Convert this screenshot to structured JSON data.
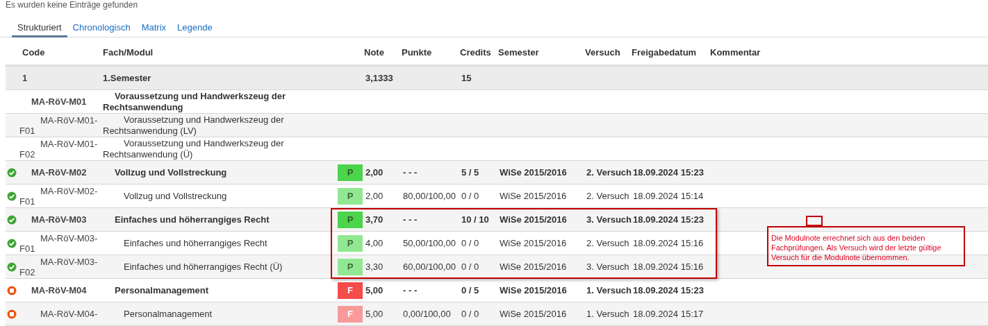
{
  "message": "Es wurden keine Einträge gefunden",
  "tabs": [
    {
      "label": "Strukturiert",
      "selected": true
    },
    {
      "label": "Chronologisch",
      "selected": false
    },
    {
      "label": "Matrix",
      "selected": false
    },
    {
      "label": "Legende",
      "selected": false
    }
  ],
  "columns": [
    "Code",
    "Fach/Modul",
    "Note",
    "Punkte",
    "Credits",
    "Semester",
    "Versuch",
    "Freigabedatum",
    "Kommentar"
  ],
  "rows": [
    {
      "kind": "semester",
      "number": "1",
      "title": "1.Semester",
      "note": "3,1333",
      "credits": "15"
    },
    {
      "kind": "module",
      "code": "MA-RöV-M01",
      "title": "Voraussetzung und Handwerkszeug der Rechtsanwendung"
    },
    {
      "kind": "exam",
      "code": "MA-RöV-M01-",
      "code_suffix": "F01",
      "title": "Voraussetzung und Handwerkszeug der Rechtsanwendung (LV)"
    },
    {
      "kind": "exam",
      "code": "MA-RöV-M01-",
      "code_suffix": "F02",
      "title": "Voraussetzung und Handwerkszeug der Rechtsanwendung (Ü)"
    },
    {
      "kind": "module",
      "passed": true,
      "code": "MA-RöV-M02",
      "title": "Vollzug und Vollstreckung",
      "badge": "P",
      "note": "2,00",
      "punkte": "- - -",
      "credits": "5 / 5",
      "semester": "WiSe 2015/2016",
      "versuch": "2. Versuch",
      "freigabe": "18.09.2024 15:23"
    },
    {
      "kind": "exam",
      "passed": true,
      "code": "MA-RöV-M02-",
      "code_suffix": "F01",
      "title": "Vollzug und Vollstreckung",
      "badge": "P",
      "note": "2,00",
      "punkte": "80,00/100,00",
      "credits": "0 / 0",
      "semester": "WiSe 2015/2016",
      "versuch": "2. Versuch",
      "freigabe": "18.09.2024 15:14"
    },
    {
      "kind": "module",
      "passed": true,
      "code": "MA-RöV-M03",
      "title": "Einfaches und höherrangiges Recht",
      "badge": "P",
      "note": "3,70",
      "punkte": "- - -",
      "credits": "10 / 10",
      "semester": "WiSe 2015/2016",
      "versuch": "3. Versuch",
      "freigabe": "18.09.2024 15:23",
      "highlighted": true
    },
    {
      "kind": "exam",
      "passed": true,
      "code": "MA-RöV-M03-",
      "code_suffix": "F01",
      "title": "Einfaches und höherrangiges Recht",
      "badge": "P",
      "note": "4,00",
      "punkte": "50,00/100,00",
      "credits": "0 / 0",
      "semester": "WiSe 2015/2016",
      "versuch": "2. Versuch",
      "freigabe": "18.09.2024 15:16",
      "highlighted": true
    },
    {
      "kind": "exam",
      "passed": true,
      "code": "MA-RöV-M03-",
      "code_suffix": "F02",
      "title": "Einfaches und höherrangiges Recht (Ü)",
      "badge": "P",
      "note": "3,30",
      "punkte": "60,00/100,00",
      "credits": "0 / 0",
      "semester": "WiSe 2015/2016",
      "versuch": "3. Versuch",
      "freigabe": "18.09.2024 15:16",
      "highlighted": true
    },
    {
      "kind": "module",
      "passed": false,
      "code": "MA-RöV-M04",
      "title": "Personalmanagement",
      "badge": "F",
      "note": "5,00",
      "punkte": "- - -",
      "credits": "0 / 5",
      "semester": "WiSe 2015/2016",
      "versuch": "1. Versuch",
      "freigabe": "18.09.2024 15:23"
    },
    {
      "kind": "exam",
      "passed": false,
      "code": "MA-RöV-M04-",
      "title": "Personalmanagement",
      "badge": "F",
      "note": "5,00",
      "punkte": "0,00/100,00",
      "credits": "0 / 0",
      "semester": "WiSe 2015/2016",
      "versuch": "1. Versuch",
      "freigabe": "18.09.2024 15:17"
    }
  ],
  "annotation": "Die Modulnote errechnet sich aus den beiden Fachprüfungen. Als Versuch wird der letzte gültige Versuch für die Modulnote übernommen."
}
